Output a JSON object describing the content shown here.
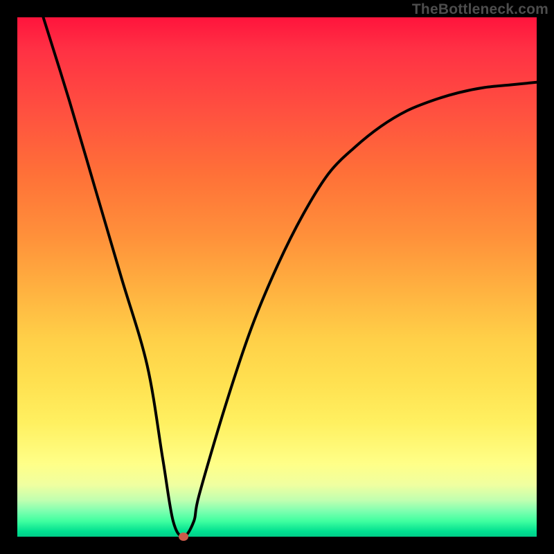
{
  "watermark": "TheBottleneck.com",
  "chart_data": {
    "type": "line",
    "title": "",
    "xlabel": "",
    "ylabel": "",
    "xlim": [
      0,
      100
    ],
    "ylim": [
      0,
      100
    ],
    "grid": false,
    "legend": false,
    "series": [
      {
        "name": "bottleneck-curve",
        "x": [
          5,
          10,
          15,
          20,
          25,
          28,
          30,
          32,
          34,
          35,
          40,
          45,
          50,
          55,
          60,
          65,
          70,
          75,
          80,
          85,
          90,
          95,
          100
        ],
        "y": [
          100,
          84,
          67,
          50,
          33,
          15,
          3,
          0,
          3,
          8,
          25,
          40,
          52,
          62,
          70,
          75,
          79,
          82,
          84,
          85.5,
          86.5,
          87,
          87.5
        ]
      }
    ],
    "background_gradient": {
      "top": "#ff143c",
      "mid": "#ffd048",
      "bottom": "#00cc88"
    },
    "marker": {
      "x": 32,
      "y": 0,
      "color": "#cc5a4a"
    }
  }
}
